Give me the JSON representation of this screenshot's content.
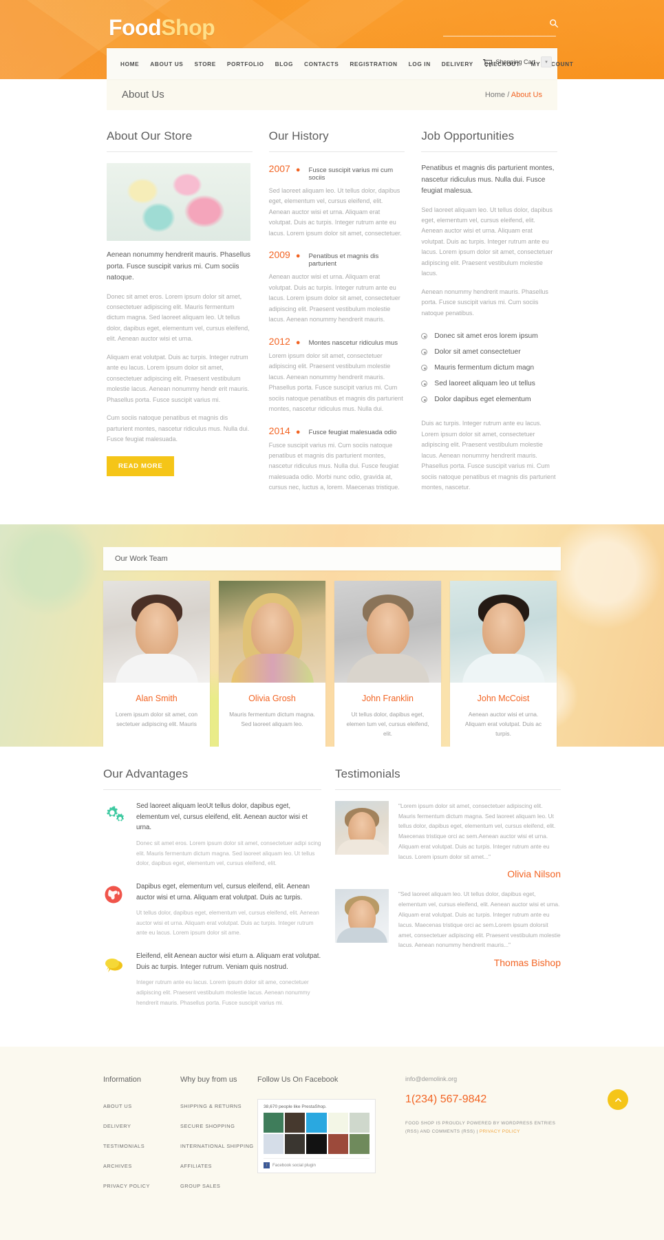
{
  "header": {
    "logo_first": "Food",
    "logo_second": "Shop",
    "search_placeholder": "",
    "search_value": "",
    "nav": [
      "HOME",
      "ABOUT US",
      "STORE",
      "PORTFOLIO",
      "BLOG",
      "CONTACTS",
      "REGISTRATION",
      "LOG IN",
      "DELIVERY",
      "CHECKOUT",
      "MY ACCOUNT"
    ],
    "cart_label": "Shopping Cart"
  },
  "breadcrumb": {
    "title": "About Us",
    "home": "Home",
    "separator": "/",
    "current": "About Us"
  },
  "about": {
    "title": "About Our Store",
    "lead": "Aenean nonummy hendrerit mauris. Phasellus porta. Fusce suscipit varius mi. Cum sociis natoque.",
    "p1": "Donec sit amet eros. Lorem ipsum dolor sit amet, consectetuer adipiscing elit. Mauris fermentum dictum magna. Sed laoreet aliquam leo. Ut tellus dolor, dapibus eget, elementum vel, cursus eleifend, elit. Aenean auctor wisi et urna.",
    "p2": "Aliquam erat volutpat. Duis ac turpis. Integer rutrum ante eu lacus. Lorem ipsum dolor sit amet, consectetuer adipiscing elit. Praesent vestibulum molestie lacus. Aenean nonummy hendr erit mauris. Phasellus porta. Fusce suscipit varius mi.",
    "p3": "Cum sociis natoque penatibus et magnis dis parturient montes, nascetur ridiculus mus. Nulla dui. Fusce feugiat malesuada.",
    "read_more": "READ MORE"
  },
  "history": {
    "title": "Our History",
    "items": [
      {
        "year": "2007",
        "label": "Fusce suscipit varius mi cum sociis",
        "text": "Sed laoreet aliquam leo. Ut tellus dolor, dapibus eget, elementum vel, cursus eleifend, elit. Aenean auctor wisi et urna. Aliquam erat volutpat. Duis ac turpis. Integer rutrum ante eu lacus. Lorem ipsum dolor sit amet, consectetuer."
      },
      {
        "year": "2009",
        "label": "Penatibus et magnis dis parturient",
        "text": "Aenean auctor wisi et urna. Aliquam erat volutpat. Duis ac turpis. Integer rutrum ante eu lacus. Lorem ipsum dolor sit amet, consectetuer adipiscing elit. Praesent vestibulum molestie lacus. Aenean nonummy hendrerit mauris."
      },
      {
        "year": "2012",
        "label": "Montes nascetur ridiculus mus",
        "text": "Lorem ipsum dolor sit amet, consectetuer adipiscing elit. Praesent vestibulum molestie lacus. Aenean nonummy hendrerit mauris. Phasellus porta. Fusce suscipit varius mi. Cum sociis natoque penatibus et magnis dis parturient montes, nascetur ridiculus mus. Nulla dui."
      },
      {
        "year": "2014",
        "label": "Fusce feugiat malesuada odio",
        "text": "Fusce suscipit varius mi. Cum sociis natoque penatibus et magnis dis parturient montes, nascetur ridiculus mus. Nulla dui. Fusce feugiat malesuada odio. Morbi nunc odio, gravida at, cursus nec, luctus a, lorem. Maecenas tristique."
      }
    ]
  },
  "jobs": {
    "title": "Job Opportunities",
    "lead": "Penatibus et magnis dis parturient montes, nascetur ridiculus mus. Nulla dui. Fusce feugiat malesua.",
    "p1": "Sed laoreet aliquam leo. Ut tellus dolor, dapibus eget, elementum vel, cursus eleifend, elit. Aenean auctor wisi et urna. Aliquam erat volutpat. Duis ac turpis. Integer rutrum ante eu lacus. Lorem ipsum dolor sit amet, consectetuer adipiscing elit. Praesent vestibulum molestie lacus.",
    "p2": "Aenean nonummy hendrerit mauris. Phasellus porta. Fusce suscipit varius mi. Cum sociis natoque penatibus.",
    "list": [
      "Donec sit amet eros lorem ipsum",
      "Dolor sit amet consectetuer",
      "Mauris fermentum dictum magn",
      "Sed laoreet aliquam leo ut tellus",
      "Dolor dapibus eget elementum"
    ],
    "p3": "Duis ac turpis. Integer rutrum ante eu lacus. Lorem ipsum dolor sit amet, consectetuer adipiscing elit. Praesent vestibulum molestie lacus. Aenean nonummy hendrerit mauris. Phasellus porta. Fusce suscipit varius mi. Cum sociis natoque penatibus et magnis dis parturient montes, nascetur."
  },
  "team": {
    "bar_title": "Our Work Team",
    "members": [
      {
        "name": "Alan Smith",
        "desc": "Lorem ipsum dolor sit amet, con sectetuer adipiscing elit. Mauris"
      },
      {
        "name": "Olivia Grosh",
        "desc": "Mauris fermentum dictum magna. Sed laoreet aliquam leo."
      },
      {
        "name": "John Franklin",
        "desc": "Ut tellus dolor, dapibus eget, elemen tum vel, cursus eleifend, elit."
      },
      {
        "name": "John McCoist",
        "desc": "Aenean auctor wisi et urna. Aliquam erat volutpat. Duis ac turpis."
      }
    ]
  },
  "advantages": {
    "title": "Our Advantages",
    "items": [
      {
        "icon": "gears-icon",
        "color": "#3cc9a0",
        "head": "Sed laoreet aliquam leoUt tellus dolor, dapibus eget, elementum vel, cursus eleifend, elit. Aenean auctor wisi et urna.",
        "body": "Donec sit amet eros. Lorem ipsum dolor sit amet, consectetuer adipi scing elit. Mauris fermentum dictum magna. Sed laoreet aliquam leo. Ut tellus dolor, dapibus eget, elementum vel, cursus eleifend, elit."
      },
      {
        "icon": "globe-icon",
        "color": "#f0544a",
        "head": "Dapibus eget, elementum vel, cursus eleifend, elit. Aenean auctor wisi et urna. Aliquam erat volutpat. Duis ac turpis.",
        "body": "Ut tellus dolor, dapibus eget, elementum vel, cursus eleifend, elit. Aenean auctor wisi et urna. Aliquam erat volutpat. Duis ac turpis. Integer rutrum ante eu lacus. Lorem ipsum dolor sit ame."
      },
      {
        "icon": "chat-bubbles-icon",
        "color": "#f5c518",
        "head": "Eleifend, elit Aenean auctor wisi eturn a. Aliquam erat volutpat. Duis ac turpis. Integer rutrum. Veniam quis nostrud.",
        "body": "Integer rutrum ante eu lacus. Lorem ipsum dolor sit ame, conectetuer adipiscing elit. Praesent vestibulum molestie lacus. Aenean nonummy hendrerit mauris. Phasellus porta. Fusce suscipit varius mi."
      }
    ]
  },
  "testimonials": {
    "title": "Testimonials",
    "items": [
      {
        "quote": "\"Lorem ipsum dolor sit amet, consectetuer adipiscing elit. Mauris fermentum dictum magna. Sed laoreet aliquam leo. Ut tellus dolor, dapibus eget, elementum vel, cursus eleifend, elit. Maecenas tristique orci ac sem.Aenean auctor wisi et urna. Aliquam erat volutpat. Duis ac turpis. Integer rutrum ante eu lacus. Lorem ipsum dolor sit amet...\"",
        "name": "Olivia Nilson"
      },
      {
        "quote": "\"Sed laoreet aliquam leo. Ut tellus dolor, dapibus eget, elementum vel, cursus eleifend, elit. Aenean auctor wisi et urna. Aliquam erat volutpat. Duis ac turpis. Integer rutrum ante eu lacus. Maecenas tristique orci ac sem.Lorem ipsum dolorsit amet, consectetuer adipiscing elit. Praesent vestibulum molestie lacus. Aenean nonummy hendrerit mauris...\"",
        "name": "Thomas Bishop"
      }
    ]
  },
  "footer": {
    "info_title": "Information",
    "info_links": [
      "ABOUT US",
      "DELIVERY",
      "TESTIMONIALS",
      "ARCHIVES",
      "PRIVACY POLICY"
    ],
    "why_title": "Why buy from us",
    "why_links": [
      "SHIPPING & RETURNS",
      "SECURE SHOPPING",
      "INTERNATIONAL SHIPPING",
      "AFFILIATES",
      "GROUP SALES"
    ],
    "facebook_title": "Follow Us On Facebook",
    "facebook_count": "38,670 people like PrestaShop.",
    "facebook_plugin": "Facebook social plugin",
    "email": "info@demolink.org",
    "phone": "1(234) 567-9842",
    "copyright": "FOOD SHOP IS PROUDLY POWERED BY WORDPRESS ENTRIES (RSS) AND COMMENTS (RSS)  |  ",
    "privacy_link": "PRIVACY POLICY"
  },
  "colors": {
    "brand_orange": "#f7941e",
    "accent_orange": "#f26322",
    "yellow": "#f5c518",
    "footer_bg": "#fbf9ef"
  }
}
